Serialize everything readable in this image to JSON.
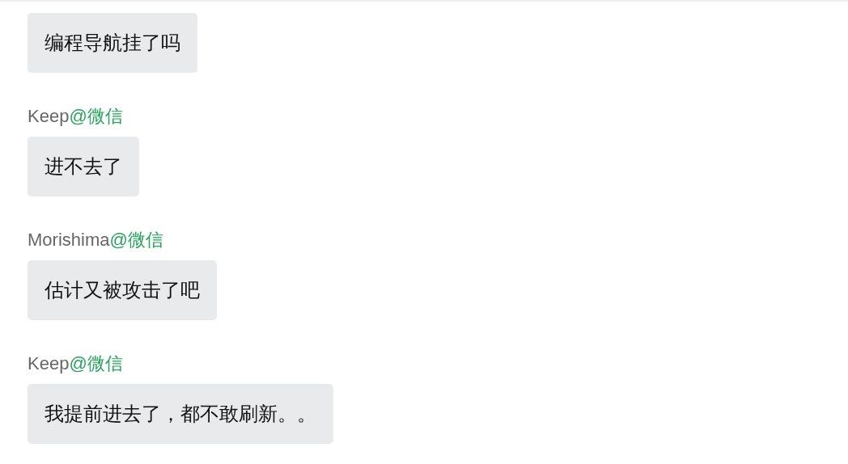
{
  "messages": [
    {
      "text": "编程导航挂了吗"
    },
    {
      "sender": {
        "name": "Keep",
        "source": "@微信"
      },
      "text": "进不去了"
    },
    {
      "sender": {
        "name": "Morishima",
        "source": "@微信"
      },
      "text": "估计又被攻击了吧"
    },
    {
      "sender": {
        "name": "Keep",
        "source": "@微信"
      },
      "text": "我提前进去了，都不敢刷新。。"
    }
  ]
}
